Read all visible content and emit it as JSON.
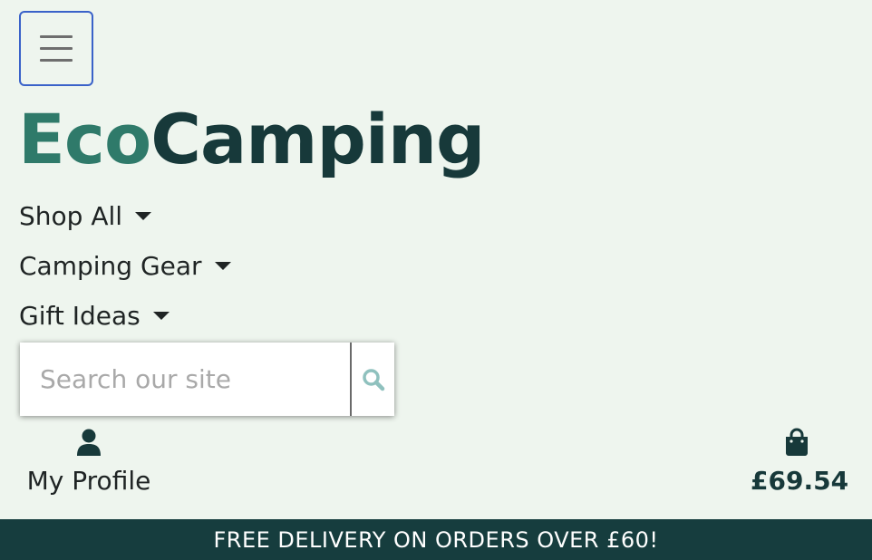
{
  "navbar": {
    "toggler_icon": "hamburger-icon"
  },
  "brand": {
    "part1": "Eco",
    "part2": "Camping",
    "color_part1": "#2f7a6a",
    "color_part2": "#17393a"
  },
  "nav": {
    "items": [
      {
        "label": "Shop All",
        "icon": "caret-down-icon"
      },
      {
        "label": "Camping Gear",
        "icon": "caret-down-icon"
      },
      {
        "label": "Gift Ideas",
        "icon": "caret-down-icon"
      }
    ]
  },
  "search": {
    "placeholder": "Search our site",
    "value": "",
    "icon": "search-icon",
    "icon_color": "#8fc1be"
  },
  "account": {
    "label": "My Profile",
    "icon": "user-icon"
  },
  "bag": {
    "total": "£69.54",
    "icon": "shopping-bag-icon"
  },
  "banner": {
    "text": "FREE DELIVERY ON ORDERS OVER £60!",
    "background": "#163d3e"
  }
}
